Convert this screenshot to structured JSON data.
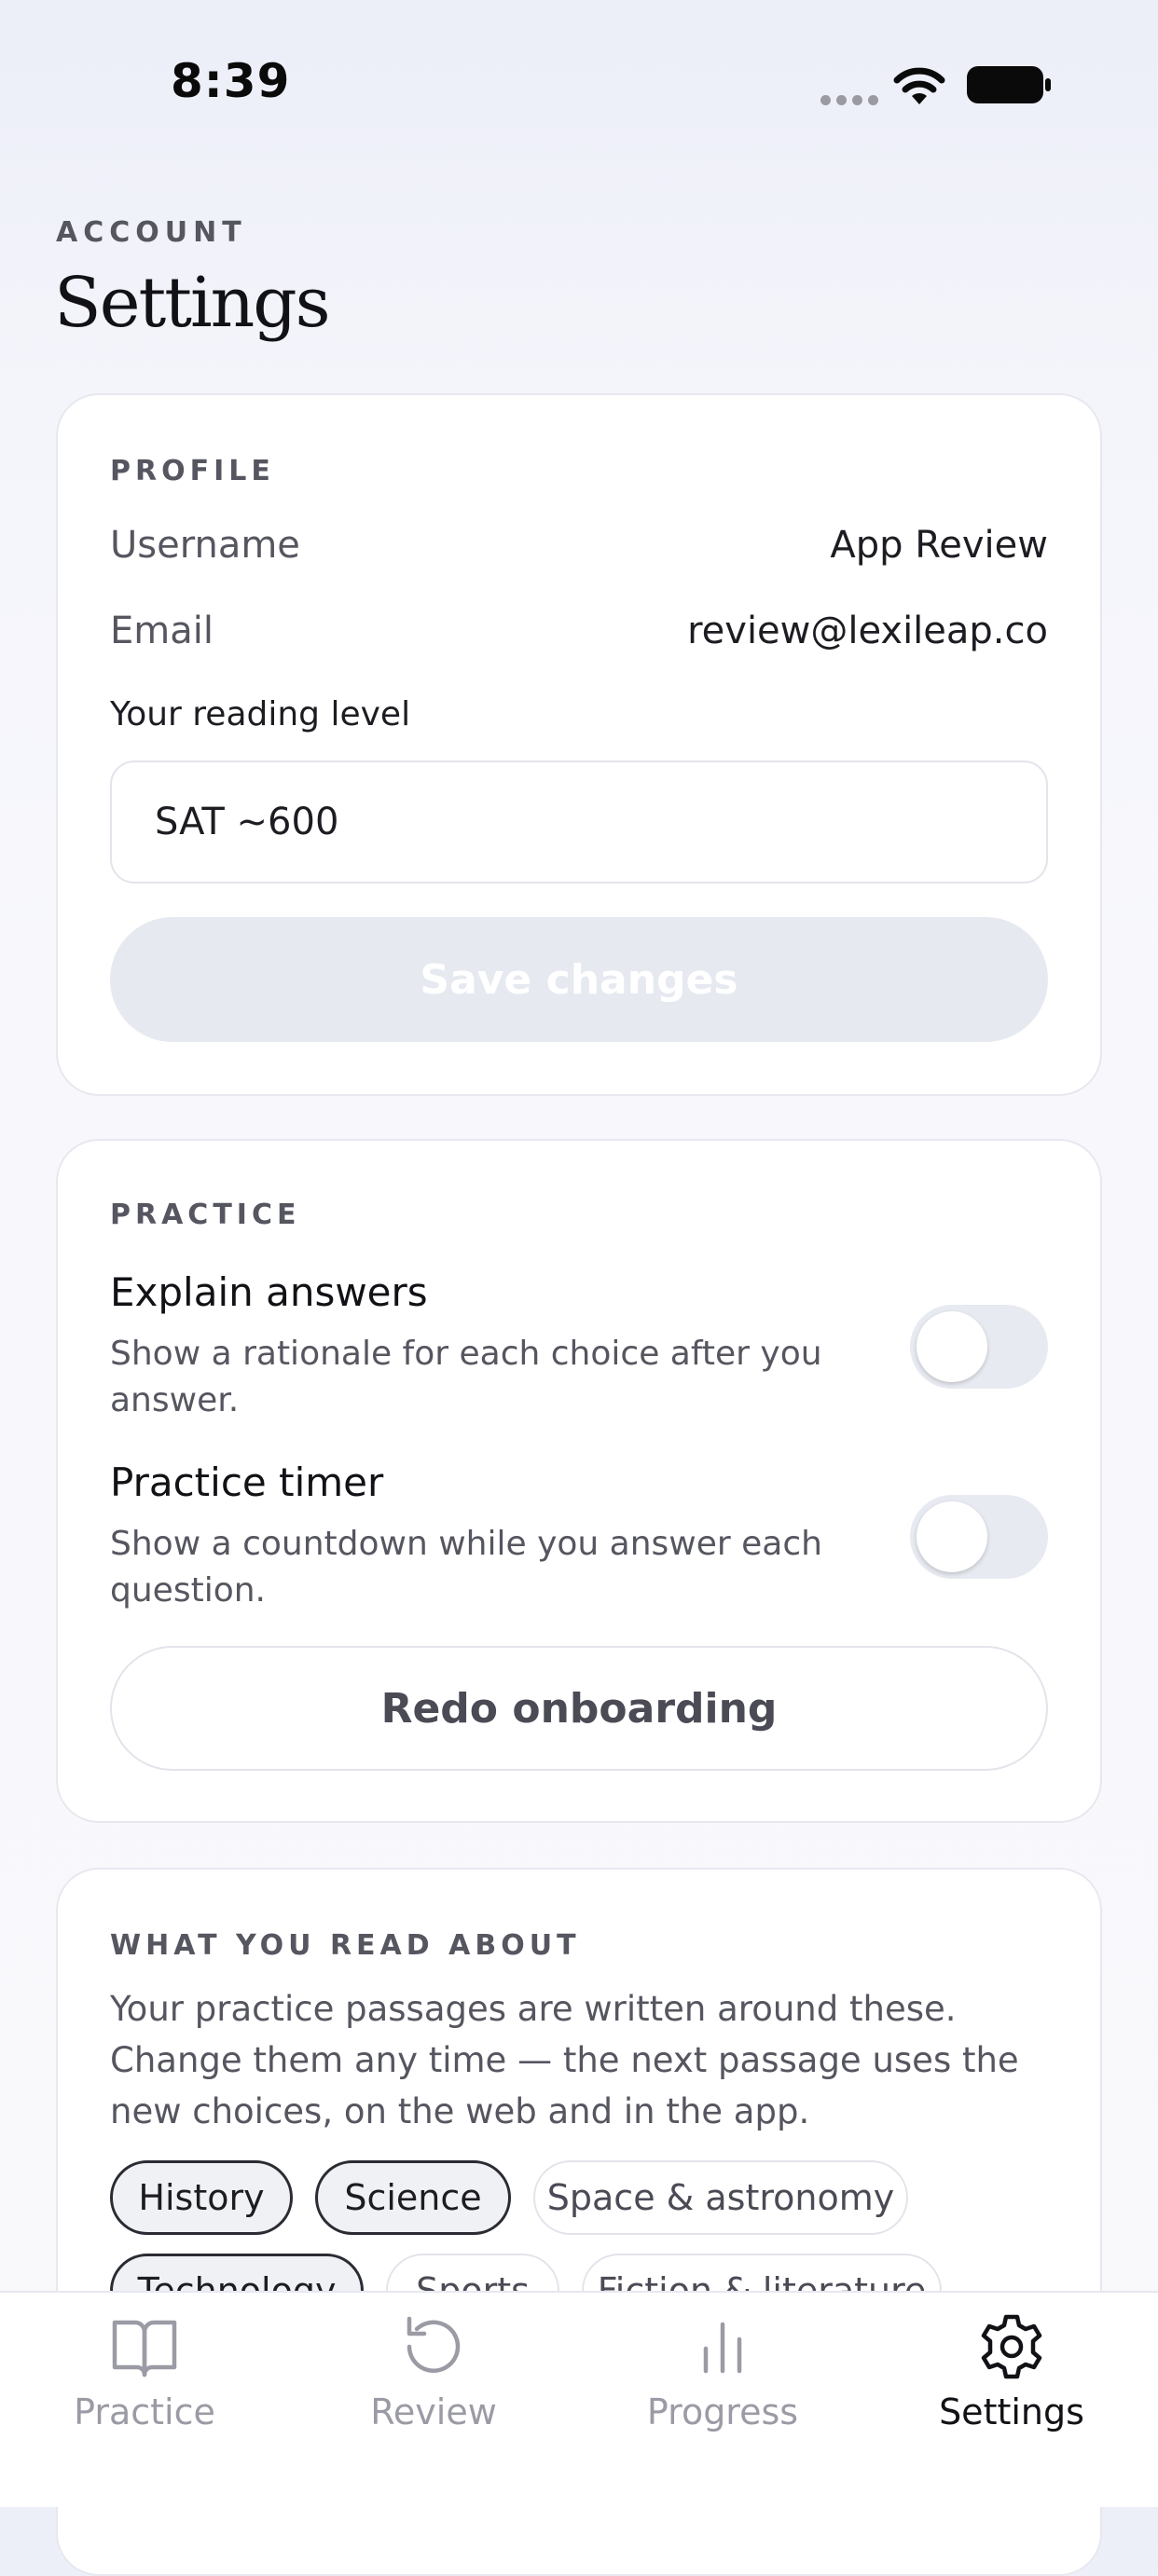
{
  "status_bar": {
    "time": "8:39"
  },
  "header": {
    "eyebrow": "ACCOUNT",
    "title": "Settings"
  },
  "profile": {
    "section_label": "PROFILE",
    "username_label": "Username",
    "username_value": "App Review",
    "email_label": "Email",
    "email_value": "review@lexileap.co",
    "reading_level_label": "Your reading level",
    "reading_level_value": "SAT ~600",
    "save_label": "Save changes"
  },
  "practice": {
    "section_label": "PRACTICE",
    "explain": {
      "title": "Explain answers",
      "description": "Show a rationale for each choice after you answer.",
      "enabled": false
    },
    "timer": {
      "title": "Practice timer",
      "description": "Show a countdown while you answer each question.",
      "enabled": false
    },
    "redo_label": "Redo onboarding"
  },
  "topics": {
    "section_label": "WHAT YOU READ ABOUT",
    "description": "Your practice passages are written around these. Change them any time — the next passage uses the new choices, on the web and in the app.",
    "chips": [
      {
        "label": "History",
        "selected": true
      },
      {
        "label": "Science",
        "selected": true
      },
      {
        "label": "Space & astronomy",
        "selected": false
      },
      {
        "label": "Technology",
        "selected": true
      },
      {
        "label": "Sports",
        "selected": false
      },
      {
        "label": "Fiction & literature",
        "selected": false
      }
    ]
  },
  "tab_bar": {
    "active": "Settings",
    "tabs": [
      {
        "label": "Practice",
        "icon": "book-icon"
      },
      {
        "label": "Review",
        "icon": "history-icon"
      },
      {
        "label": "Progress",
        "icon": "bar-chart-icon"
      },
      {
        "label": "Settings",
        "icon": "gear-icon"
      }
    ]
  },
  "colors": {
    "accent_dark": "#111116",
    "muted": "#55565f",
    "inactive_tab": "#9a9ba4",
    "disabled_button": "#e6e9f0"
  }
}
